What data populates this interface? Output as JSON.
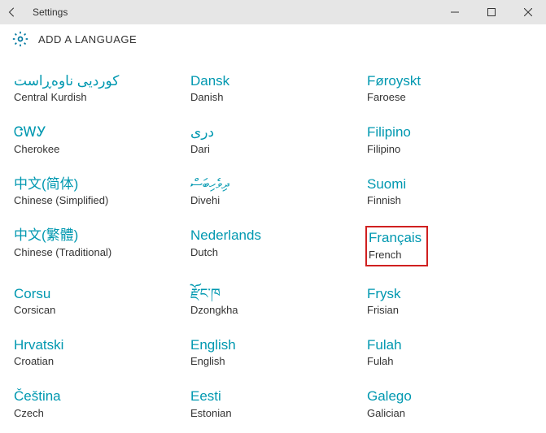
{
  "titlebar": {
    "title": "Settings"
  },
  "header": {
    "title": "ADD A LANGUAGE"
  },
  "languages": [
    {
      "native": "کوردیی ناوەڕاست",
      "english": "Central Kurdish",
      "highlighted": false
    },
    {
      "native": "Dansk",
      "english": "Danish",
      "highlighted": false
    },
    {
      "native": "Føroyskt",
      "english": "Faroese",
      "highlighted": false
    },
    {
      "native": "ᏣᎳᎩ",
      "english": "Cherokee",
      "highlighted": false
    },
    {
      "native": "درى",
      "english": "Dari",
      "highlighted": false
    },
    {
      "native": "Filipino",
      "english": "Filipino",
      "highlighted": false
    },
    {
      "native": "中文(简体)",
      "english": "Chinese (Simplified)",
      "highlighted": false
    },
    {
      "native": "ދިވެހިބަސް",
      "english": "Divehi",
      "highlighted": false
    },
    {
      "native": "Suomi",
      "english": "Finnish",
      "highlighted": false
    },
    {
      "native": "中文(繁體)",
      "english": "Chinese (Traditional)",
      "highlighted": false
    },
    {
      "native": "Nederlands",
      "english": "Dutch",
      "highlighted": false
    },
    {
      "native": "Français",
      "english": "French",
      "highlighted": true
    },
    {
      "native": "Corsu",
      "english": "Corsican",
      "highlighted": false
    },
    {
      "native": "རྫོང་ཁ",
      "english": "Dzongkha",
      "highlighted": false
    },
    {
      "native": "Frysk",
      "english": "Frisian",
      "highlighted": false
    },
    {
      "native": "Hrvatski",
      "english": "Croatian",
      "highlighted": false
    },
    {
      "native": "English",
      "english": "English",
      "highlighted": false
    },
    {
      "native": "Fulah",
      "english": "Fulah",
      "highlighted": false
    },
    {
      "native": "Čeština",
      "english": "Czech",
      "highlighted": false
    },
    {
      "native": "Eesti",
      "english": "Estonian",
      "highlighted": false
    },
    {
      "native": "Galego",
      "english": "Galician",
      "highlighted": false
    }
  ]
}
